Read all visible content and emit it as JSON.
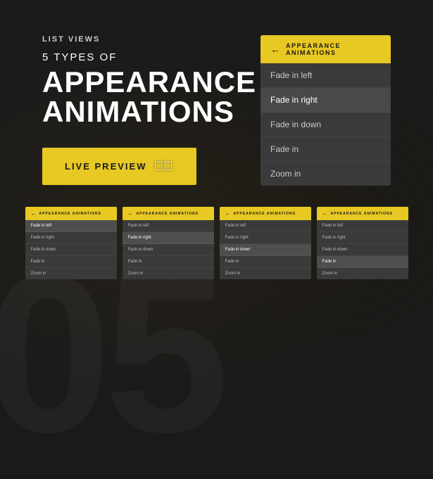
{
  "watermark": "05",
  "left": {
    "category": "LIST VIEWS",
    "subtitle": "5 TYPES OF",
    "title": "APPEARANCE\nANIMATIONS",
    "preview_button": "LIVE PREVIEW"
  },
  "menu": {
    "header": "APPEARANCE ANIMATIONS",
    "back_arrow": "←",
    "items": [
      {
        "label": "Fade in left",
        "active": false
      },
      {
        "label": "Fade in right",
        "active": true
      },
      {
        "label": "Fade in down",
        "active": false
      },
      {
        "label": "Fade in",
        "active": false
      },
      {
        "label": "Zoom in",
        "active": false
      }
    ]
  },
  "small_cards": [
    {
      "header": "APPEARANCE ANIMATIONS",
      "items": [
        "Fade in left",
        "Fade in right",
        "Fade in down",
        "Fade in",
        "Zoom in"
      ],
      "active_index": 1
    },
    {
      "header": "APPEARANCE ANIMATIONS",
      "items": [
        "Fade in left",
        "Fade in right",
        "Fade in down",
        "Fade in",
        "Zoom in"
      ],
      "active_index": 2
    },
    {
      "header": "APPEARANCE ANIMATIONS",
      "items": [
        "Fade in left",
        "Fade in right",
        "Fade in down",
        "Fade in",
        "Zoom in"
      ],
      "active_index": 3
    },
    {
      "header": "APPEARANCE ANIMATIONS",
      "items": [
        "Fade in left",
        "Fade in right",
        "Fade in down",
        "Fade in",
        "Zoom in"
      ],
      "active_index": 4
    }
  ]
}
